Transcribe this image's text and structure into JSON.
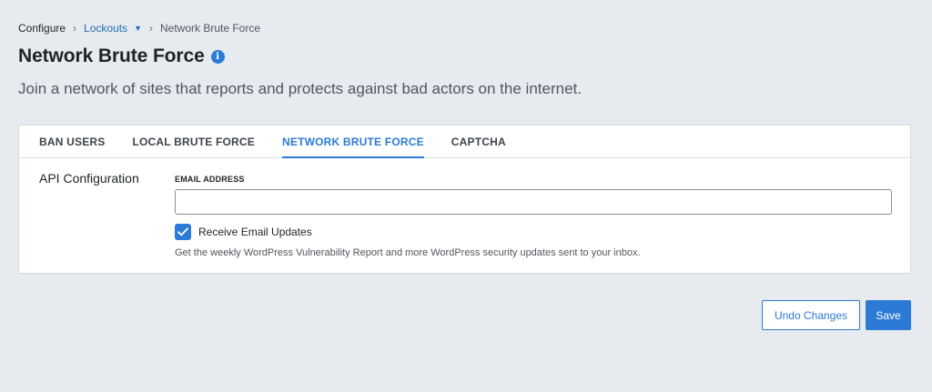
{
  "breadcrumb": {
    "root": "Configure",
    "section": "Lockouts",
    "current": "Network Brute Force"
  },
  "header": {
    "title": "Network Brute Force",
    "subtitle": "Join a network of sites that reports and protects against bad actors on the internet."
  },
  "tabs": [
    {
      "label": "BAN USERS",
      "active": false
    },
    {
      "label": "LOCAL BRUTE FORCE",
      "active": false
    },
    {
      "label": "NETWORK BRUTE FORCE",
      "active": true
    },
    {
      "label": "CAPTCHA",
      "active": false
    }
  ],
  "api_config": {
    "section_label": "API Configuration",
    "email_label": "EMAIL ADDRESS",
    "email_value": "",
    "email_placeholder": "",
    "updates_checkbox": {
      "label": "Receive Email Updates",
      "checked": true
    },
    "help_text": "Get the weekly WordPress Vulnerability Report and more WordPress security updates sent to your inbox."
  },
  "actions": {
    "undo_label": "Undo Changes",
    "save_label": "Save"
  },
  "colors": {
    "accent": "#2b7bd6",
    "background": "#e7eaee"
  },
  "icons": {
    "info": "info-icon",
    "caret": "caret-down-icon",
    "check": "check-icon"
  }
}
